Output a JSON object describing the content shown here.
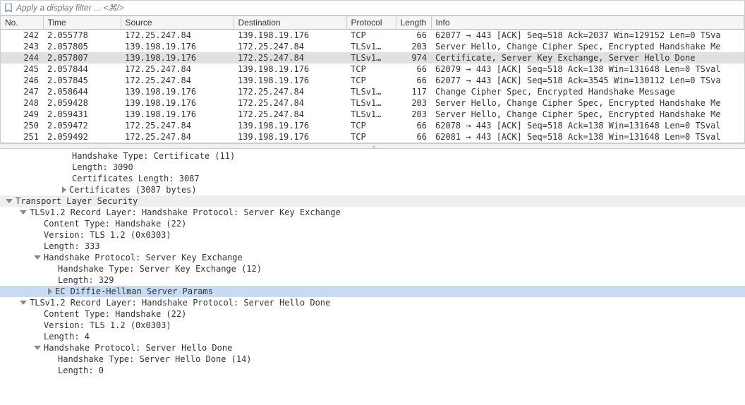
{
  "filter": {
    "placeholder": "Apply a display filter ... <⌘/>"
  },
  "columns": [
    "No.",
    "Time",
    "Source",
    "Destination",
    "Protocol",
    "Length",
    "Info"
  ],
  "packets": [
    {
      "no": "242",
      "time": "2.055778",
      "src": "172.25.247.84",
      "dst": "139.198.19.176",
      "proto": "TCP",
      "len": "66",
      "info": "62077 → 443 [ACK] Seq=518 Ack=2037 Win=129152 Len=0 TSva"
    },
    {
      "no": "243",
      "time": "2.057805",
      "src": "139.198.19.176",
      "dst": "172.25.247.84",
      "proto": "TLSv1…",
      "len": "203",
      "info": "Server Hello, Change Cipher Spec, Encrypted Handshake Me"
    },
    {
      "no": "244",
      "time": "2.057807",
      "src": "139.198.19.176",
      "dst": "172.25.247.84",
      "proto": "TLSv1…",
      "len": "974",
      "info": "Certificate, Server Key Exchange, Server Hello Done",
      "selected": true
    },
    {
      "no": "245",
      "time": "2.057844",
      "src": "172.25.247.84",
      "dst": "139.198.19.176",
      "proto": "TCP",
      "len": "66",
      "info": "62079 → 443 [ACK] Seq=518 Ack=138 Win=131648 Len=0 TSval"
    },
    {
      "no": "246",
      "time": "2.057845",
      "src": "172.25.247.84",
      "dst": "139.198.19.176",
      "proto": "TCP",
      "len": "66",
      "info": "62077 → 443 [ACK] Seq=518 Ack=3545 Win=130112 Len=0 TSva"
    },
    {
      "no": "247",
      "time": "2.058644",
      "src": "139.198.19.176",
      "dst": "172.25.247.84",
      "proto": "TLSv1…",
      "len": "117",
      "info": "Change Cipher Spec, Encrypted Handshake Message"
    },
    {
      "no": "248",
      "time": "2.059428",
      "src": "139.198.19.176",
      "dst": "172.25.247.84",
      "proto": "TLSv1…",
      "len": "203",
      "info": "Server Hello, Change Cipher Spec, Encrypted Handshake Me"
    },
    {
      "no": "249",
      "time": "2.059431",
      "src": "139.198.19.176",
      "dst": "172.25.247.84",
      "proto": "TLSv1…",
      "len": "203",
      "info": "Server Hello, Change Cipher Spec, Encrypted Handshake Me"
    },
    {
      "no": "250",
      "time": "2.059472",
      "src": "172.25.247.84",
      "dst": "139.198.19.176",
      "proto": "TCP",
      "len": "66",
      "info": "62078 → 443 [ACK] Seq=518 Ack=138 Win=131648 Len=0 TSval"
    },
    {
      "no": "251",
      "time": "2.059492",
      "src": "172.25.247.84",
      "dst": "139.198.19.176",
      "proto": "TCP",
      "len": "66",
      "info": "62081 → 443 [ACK] Seq=518 Ack=138 Win=131648 Len=0 TSval"
    }
  ],
  "details": [
    {
      "indent": 4,
      "tri": "",
      "text": "Handshake Type: Certificate (11)"
    },
    {
      "indent": 4,
      "tri": "",
      "text": "Length: 3090"
    },
    {
      "indent": 4,
      "tri": "",
      "text": "Certificates Length: 3087"
    },
    {
      "indent": 4,
      "tri": "right",
      "text": "Certificates (3087 bytes)"
    },
    {
      "indent": 0,
      "tri": "down",
      "text": "Transport Layer Security",
      "cls": "section"
    },
    {
      "indent": 1,
      "tri": "down",
      "text": "TLSv1.2 Record Layer: Handshake Protocol: Server Key Exchange"
    },
    {
      "indent": 2,
      "tri": "",
      "text": "Content Type: Handshake (22)"
    },
    {
      "indent": 2,
      "tri": "",
      "text": "Version: TLS 1.2 (0x0303)"
    },
    {
      "indent": 2,
      "tri": "",
      "text": "Length: 333"
    },
    {
      "indent": 2,
      "tri": "down",
      "text": "Handshake Protocol: Server Key Exchange"
    },
    {
      "indent": 3,
      "tri": "",
      "text": "Handshake Type: Server Key Exchange (12)"
    },
    {
      "indent": 3,
      "tri": "",
      "text": "Length: 329"
    },
    {
      "indent": 3,
      "tri": "right",
      "text": "EC Diffie-Hellman Server Params",
      "cls": "highlight"
    },
    {
      "indent": 1,
      "tri": "down",
      "text": "TLSv1.2 Record Layer: Handshake Protocol: Server Hello Done"
    },
    {
      "indent": 2,
      "tri": "",
      "text": "Content Type: Handshake (22)"
    },
    {
      "indent": 2,
      "tri": "",
      "text": "Version: TLS 1.2 (0x0303)"
    },
    {
      "indent": 2,
      "tri": "",
      "text": "Length: 4"
    },
    {
      "indent": 2,
      "tri": "down",
      "text": "Handshake Protocol: Server Hello Done"
    },
    {
      "indent": 3,
      "tri": "",
      "text": "Handshake Type: Server Hello Done (14)"
    },
    {
      "indent": 3,
      "tri": "",
      "text": "Length: 0"
    }
  ]
}
